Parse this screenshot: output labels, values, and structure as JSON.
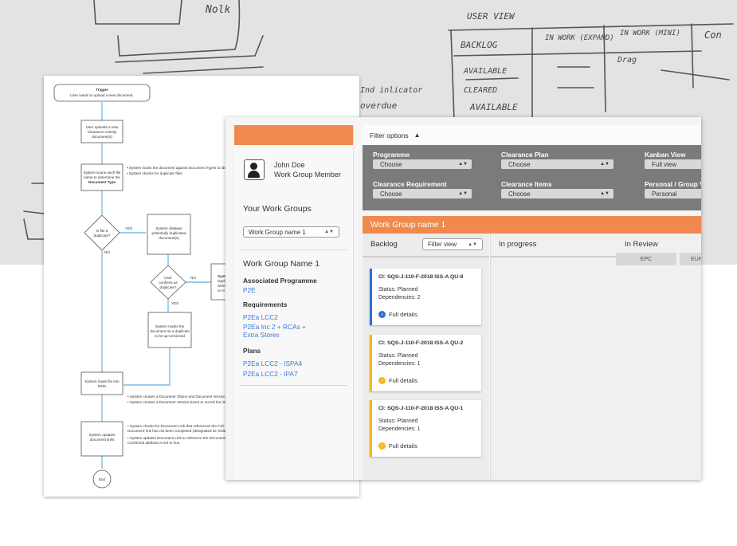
{
  "sketch": {
    "lines": [
      "Nolk",
      "USER VIEW",
      "BACKLOG",
      "IN WORK (EXPAND)",
      "IN WORK (MINI)",
      "Con",
      "AVAILABLE",
      "CLEARED",
      "AVAILABLE",
      "Drag",
      "overdue",
      "Ind inlicator"
    ]
  },
  "flowchart": {
    "trigger_title": "Trigger",
    "trigger_text": "User wants to upload a new document.",
    "step1": [
      "User uploads a new",
      "Clearance Activity",
      "document(s)"
    ],
    "step2": [
      "System scans each file",
      "name to determine the",
      "Document Type"
    ],
    "step2_notes": [
      "• System scans the document against Document Types to identify",
      "• System checks for duplicate files"
    ],
    "decision1": [
      "Is file a",
      "duplicate?"
    ],
    "yes_label": "YES",
    "no_label": "NO",
    "step3": [
      "System displays",
      "potentially duplicated",
      "document(s)"
    ],
    "decision2": [
      "User",
      "confirms as",
      "duplicate?"
    ],
    "step4_partial": [
      "Syst",
      "duplic",
      "which",
      "or N"
    ],
    "step5": [
      "System marks the",
      "document as a duplicate",
      "to be up-versioned"
    ],
    "step6": [
      "System loads file into",
      "DMS"
    ],
    "step6_notes": [
      "• System creates a Document Object and Document Version to record",
      "• System creates a Document Version Event to record the initial"
    ],
    "step7": [
      "System updates",
      "document links"
    ],
    "step7_notes": [
      "• System checks for Document Link that references the Full Title",
      "  Document' link has not been completed (designated as 'initial'",
      "• System updates Document Link to reference the Document",
      "  Confirmed attribute is set to true."
    ],
    "end_label": "End"
  },
  "app": {
    "user": {
      "name": "John Doe",
      "role": "Work Group Member"
    },
    "your_work_groups_title": "Your Work Groups",
    "work_group_select": "Work Group name 1",
    "work_group_name": "Work Group Name 1",
    "assoc_programme_label": "Associated Programme",
    "assoc_programme": "P2E",
    "requirements_label": "Requirements",
    "requirements": [
      "P2Ea LCC2",
      "P2Ea Inc 2 + RCAs +",
      "Extra Stores"
    ],
    "plans_label": "Plans",
    "plans": [
      "P2Ea LCC2 - ISPA4",
      "P2Ea LCC2 - IPA7"
    ],
    "filter_options_label": "Filter options",
    "filters": {
      "programme_label": "Programme",
      "programme_value": "Choose",
      "clearance_plan_label": "Clearance Plan",
      "clearance_plan_value": "Choose",
      "kanban_view_label": "Kanban View",
      "kanban_view_value": "Full view",
      "clearance_req_label": "Clearance Requirement",
      "clearance_req_value": "Choose",
      "clearance_items_label": "Clearance Items",
      "clearance_items_value": "Choose",
      "personal_group_label": "Personal / Group Vie",
      "personal_group_value": "Personal"
    },
    "board_title": "Work Group name 1",
    "columns": {
      "backlog": "Backlog",
      "backlog_filter": "Filter view",
      "in_progress": "In progress",
      "in_review": "In Review",
      "review_tabs": [
        "EPC",
        "EUF"
      ]
    },
    "cards": [
      {
        "id": "CI: SQS-J-110-F-2018 ISS-A QU-8",
        "status": "Status: Planned",
        "deps": "Dependencies: 2",
        "details": "Full details",
        "color": "#2d6fd6"
      },
      {
        "id": "CI: SQS-J-110-F-2018 ISS-A QU-2",
        "status": "Status: Planned",
        "deps": "Dependencies: 1",
        "details": "Full details",
        "color": "#f3b81f"
      },
      {
        "id": "CI: SQS-J-110-F-2018 ISS-A QU-1",
        "status": "Status: Planned",
        "deps": "Dependencies: 1",
        "details": "Full details",
        "color": "#f3b81f"
      }
    ],
    "colors": {
      "accent": "#f0894e",
      "filter_bg": "#7b7b7b",
      "link": "#3a78d8"
    }
  }
}
